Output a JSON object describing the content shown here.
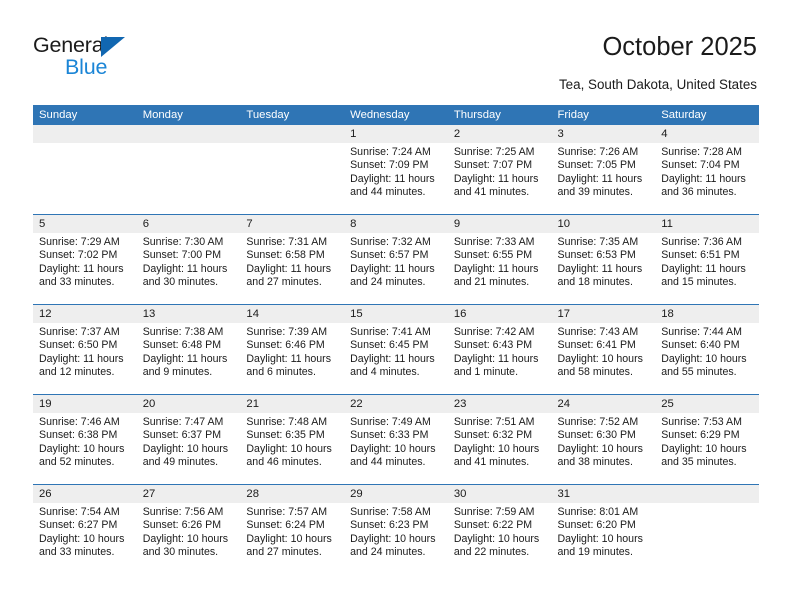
{
  "brand": {
    "name_part1": "General",
    "name_part2": "Blue",
    "triangle_color": "#1167b1",
    "blue_text_color": "#1b85d6"
  },
  "header": {
    "title": "October 2025",
    "subtitle": "Tea, South Dakota, United States"
  },
  "theme": {
    "header_blue": "#2f75b5",
    "daynum_strip": "#eeeeee",
    "text": "#1b1b1b"
  },
  "calendar": {
    "weekday_headers": [
      "Sunday",
      "Monday",
      "Tuesday",
      "Wednesday",
      "Thursday",
      "Friday",
      "Saturday"
    ],
    "labels": {
      "sunrise": "Sunrise:",
      "sunset": "Sunset:",
      "daylight": "Daylight:"
    },
    "weeks": [
      [
        {
          "day": "",
          "empty": true
        },
        {
          "day": "",
          "empty": true
        },
        {
          "day": "",
          "empty": true
        },
        {
          "day": "1",
          "sunrise": "Sunrise: 7:24 AM",
          "sunset": "Sunset: 7:09 PM",
          "daylight1": "Daylight: 11 hours",
          "daylight2": "and 44 minutes."
        },
        {
          "day": "2",
          "sunrise": "Sunrise: 7:25 AM",
          "sunset": "Sunset: 7:07 PM",
          "daylight1": "Daylight: 11 hours",
          "daylight2": "and 41 minutes."
        },
        {
          "day": "3",
          "sunrise": "Sunrise: 7:26 AM",
          "sunset": "Sunset: 7:05 PM",
          "daylight1": "Daylight: 11 hours",
          "daylight2": "and 39 minutes."
        },
        {
          "day": "4",
          "sunrise": "Sunrise: 7:28 AM",
          "sunset": "Sunset: 7:04 PM",
          "daylight1": "Daylight: 11 hours",
          "daylight2": "and 36 minutes."
        }
      ],
      [
        {
          "day": "5",
          "sunrise": "Sunrise: 7:29 AM",
          "sunset": "Sunset: 7:02 PM",
          "daylight1": "Daylight: 11 hours",
          "daylight2": "and 33 minutes."
        },
        {
          "day": "6",
          "sunrise": "Sunrise: 7:30 AM",
          "sunset": "Sunset: 7:00 PM",
          "daylight1": "Daylight: 11 hours",
          "daylight2": "and 30 minutes."
        },
        {
          "day": "7",
          "sunrise": "Sunrise: 7:31 AM",
          "sunset": "Sunset: 6:58 PM",
          "daylight1": "Daylight: 11 hours",
          "daylight2": "and 27 minutes."
        },
        {
          "day": "8",
          "sunrise": "Sunrise: 7:32 AM",
          "sunset": "Sunset: 6:57 PM",
          "daylight1": "Daylight: 11 hours",
          "daylight2": "and 24 minutes."
        },
        {
          "day": "9",
          "sunrise": "Sunrise: 7:33 AM",
          "sunset": "Sunset: 6:55 PM",
          "daylight1": "Daylight: 11 hours",
          "daylight2": "and 21 minutes."
        },
        {
          "day": "10",
          "sunrise": "Sunrise: 7:35 AM",
          "sunset": "Sunset: 6:53 PM",
          "daylight1": "Daylight: 11 hours",
          "daylight2": "and 18 minutes."
        },
        {
          "day": "11",
          "sunrise": "Sunrise: 7:36 AM",
          "sunset": "Sunset: 6:51 PM",
          "daylight1": "Daylight: 11 hours",
          "daylight2": "and 15 minutes."
        }
      ],
      [
        {
          "day": "12",
          "sunrise": "Sunrise: 7:37 AM",
          "sunset": "Sunset: 6:50 PM",
          "daylight1": "Daylight: 11 hours",
          "daylight2": "and 12 minutes."
        },
        {
          "day": "13",
          "sunrise": "Sunrise: 7:38 AM",
          "sunset": "Sunset: 6:48 PM",
          "daylight1": "Daylight: 11 hours",
          "daylight2": "and 9 minutes."
        },
        {
          "day": "14",
          "sunrise": "Sunrise: 7:39 AM",
          "sunset": "Sunset: 6:46 PM",
          "daylight1": "Daylight: 11 hours",
          "daylight2": "and 6 minutes."
        },
        {
          "day": "15",
          "sunrise": "Sunrise: 7:41 AM",
          "sunset": "Sunset: 6:45 PM",
          "daylight1": "Daylight: 11 hours",
          "daylight2": "and 4 minutes."
        },
        {
          "day": "16",
          "sunrise": "Sunrise: 7:42 AM",
          "sunset": "Sunset: 6:43 PM",
          "daylight1": "Daylight: 11 hours",
          "daylight2": "and 1 minute."
        },
        {
          "day": "17",
          "sunrise": "Sunrise: 7:43 AM",
          "sunset": "Sunset: 6:41 PM",
          "daylight1": "Daylight: 10 hours",
          "daylight2": "and 58 minutes."
        },
        {
          "day": "18",
          "sunrise": "Sunrise: 7:44 AM",
          "sunset": "Sunset: 6:40 PM",
          "daylight1": "Daylight: 10 hours",
          "daylight2": "and 55 minutes."
        }
      ],
      [
        {
          "day": "19",
          "sunrise": "Sunrise: 7:46 AM",
          "sunset": "Sunset: 6:38 PM",
          "daylight1": "Daylight: 10 hours",
          "daylight2": "and 52 minutes."
        },
        {
          "day": "20",
          "sunrise": "Sunrise: 7:47 AM",
          "sunset": "Sunset: 6:37 PM",
          "daylight1": "Daylight: 10 hours",
          "daylight2": "and 49 minutes."
        },
        {
          "day": "21",
          "sunrise": "Sunrise: 7:48 AM",
          "sunset": "Sunset: 6:35 PM",
          "daylight1": "Daylight: 10 hours",
          "daylight2": "and 46 minutes."
        },
        {
          "day": "22",
          "sunrise": "Sunrise: 7:49 AM",
          "sunset": "Sunset: 6:33 PM",
          "daylight1": "Daylight: 10 hours",
          "daylight2": "and 44 minutes."
        },
        {
          "day": "23",
          "sunrise": "Sunrise: 7:51 AM",
          "sunset": "Sunset: 6:32 PM",
          "daylight1": "Daylight: 10 hours",
          "daylight2": "and 41 minutes."
        },
        {
          "day": "24",
          "sunrise": "Sunrise: 7:52 AM",
          "sunset": "Sunset: 6:30 PM",
          "daylight1": "Daylight: 10 hours",
          "daylight2": "and 38 minutes."
        },
        {
          "day": "25",
          "sunrise": "Sunrise: 7:53 AM",
          "sunset": "Sunset: 6:29 PM",
          "daylight1": "Daylight: 10 hours",
          "daylight2": "and 35 minutes."
        }
      ],
      [
        {
          "day": "26",
          "sunrise": "Sunrise: 7:54 AM",
          "sunset": "Sunset: 6:27 PM",
          "daylight1": "Daylight: 10 hours",
          "daylight2": "and 33 minutes."
        },
        {
          "day": "27",
          "sunrise": "Sunrise: 7:56 AM",
          "sunset": "Sunset: 6:26 PM",
          "daylight1": "Daylight: 10 hours",
          "daylight2": "and 30 minutes."
        },
        {
          "day": "28",
          "sunrise": "Sunrise: 7:57 AM",
          "sunset": "Sunset: 6:24 PM",
          "daylight1": "Daylight: 10 hours",
          "daylight2": "and 27 minutes."
        },
        {
          "day": "29",
          "sunrise": "Sunrise: 7:58 AM",
          "sunset": "Sunset: 6:23 PM",
          "daylight1": "Daylight: 10 hours",
          "daylight2": "and 24 minutes."
        },
        {
          "day": "30",
          "sunrise": "Sunrise: 7:59 AM",
          "sunset": "Sunset: 6:22 PM",
          "daylight1": "Daylight: 10 hours",
          "daylight2": "and 22 minutes."
        },
        {
          "day": "31",
          "sunrise": "Sunrise: 8:01 AM",
          "sunset": "Sunset: 6:20 PM",
          "daylight1": "Daylight: 10 hours",
          "daylight2": "and 19 minutes."
        },
        {
          "day": "",
          "empty": true
        }
      ]
    ]
  }
}
